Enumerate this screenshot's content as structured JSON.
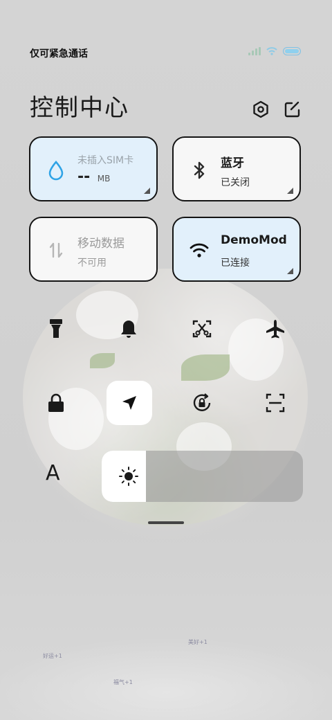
{
  "status_bar": {
    "carrier_text": "仅可紧急通话"
  },
  "header": {
    "title": "控制中心",
    "settings_icon": "hexagon-settings-icon",
    "edit_icon": "edit-icon"
  },
  "tiles": [
    {
      "id": "data-usage",
      "icon": "water-drop-icon",
      "line1": "未插入SIM卡",
      "value": "--",
      "unit": "MB"
    },
    {
      "id": "bluetooth",
      "icon": "bluetooth-icon",
      "line1": "蓝牙",
      "line2": "已关闭"
    },
    {
      "id": "mobile-data",
      "icon": "mobile-data-icon",
      "line1": "移动数据",
      "line2": "不可用"
    },
    {
      "id": "wifi",
      "icon": "wifi-icon",
      "line1": "DemoMod",
      "line2": "已连接"
    }
  ],
  "toggles": [
    "flashlight-icon",
    "bell-icon",
    "screenshot-icon",
    "airplane-icon",
    "lock-icon",
    "location-icon",
    "rotation-lock-icon",
    "scan-icon"
  ],
  "font_label": "A",
  "brightness": {
    "level": 0.22
  },
  "wallpaper_text": [
    "好运+1",
    "美好+1",
    "福气+1"
  ],
  "colors": {
    "accent_blue": "#2fa3e6",
    "tile_active": "#e2f0fb"
  }
}
